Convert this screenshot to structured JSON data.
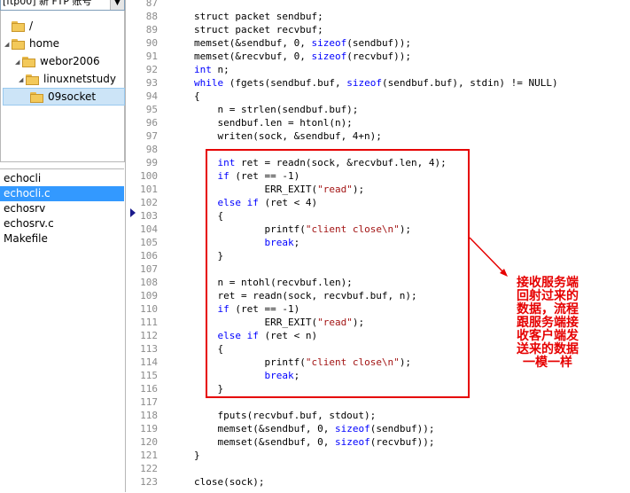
{
  "site_combo": {
    "label": "[ftp00] 新 FTP 账号"
  },
  "tree": [
    {
      "label": "/",
      "expander": ""
    },
    {
      "label": "home",
      "expander": "◢"
    },
    {
      "label": "webor2006",
      "expander": "◢"
    },
    {
      "label": "linuxnetstudy",
      "expander": "◢"
    },
    {
      "label": "09socket",
      "expander": ""
    }
  ],
  "files": [
    "echocli",
    "echocli.c",
    "echosrv",
    "echosrv.c",
    "Makefile"
  ],
  "selected_file": "echocli.c",
  "code_lines": [
    {
      "n": "87",
      "segs": []
    },
    {
      "n": "88",
      "segs": [
        {
          "t": "struct packet sendbuf;",
          "c": "n"
        }
      ]
    },
    {
      "n": "89",
      "segs": [
        {
          "t": "struct packet recvbuf;",
          "c": "n"
        }
      ]
    },
    {
      "n": "90",
      "segs": [
        {
          "t": "memset(&sendbuf, 0, ",
          "c": "n"
        },
        {
          "t": "sizeof",
          "c": "k"
        },
        {
          "t": "(sendbuf));",
          "c": "n"
        }
      ]
    },
    {
      "n": "91",
      "segs": [
        {
          "t": "memset(&recvbuf, 0, ",
          "c": "n"
        },
        {
          "t": "sizeof",
          "c": "k"
        },
        {
          "t": "(recvbuf));",
          "c": "n"
        }
      ]
    },
    {
      "n": "92",
      "segs": [
        {
          "t": "int",
          "c": "k"
        },
        {
          "t": " n;",
          "c": "n"
        }
      ]
    },
    {
      "n": "93",
      "segs": [
        {
          "t": "while",
          "c": "k"
        },
        {
          "t": " (fgets(sendbuf.buf, ",
          "c": "n"
        },
        {
          "t": "sizeof",
          "c": "k"
        },
        {
          "t": "(sendbuf.buf), stdin) != NULL)",
          "c": "n"
        }
      ]
    },
    {
      "n": "94",
      "segs": [
        {
          "t": "{",
          "c": "n"
        }
      ]
    },
    {
      "n": "95",
      "segs": [
        {
          "t": "    n = strlen(sendbuf.buf);",
          "c": "n"
        }
      ]
    },
    {
      "n": "96",
      "segs": [
        {
          "t": "    sendbuf.len = htonl(n);",
          "c": "n"
        }
      ]
    },
    {
      "n": "97",
      "segs": [
        {
          "t": "    writen(sock, &sendbuf, 4+n);",
          "c": "n"
        }
      ]
    },
    {
      "n": "98",
      "segs": []
    },
    {
      "n": "99",
      "segs": [
        {
          "t": "    ",
          "c": "n"
        },
        {
          "t": "int",
          "c": "k"
        },
        {
          "t": " ret = readn(sock, &recvbuf.len, 4);",
          "c": "n"
        }
      ]
    },
    {
      "n": "100",
      "segs": [
        {
          "t": "    ",
          "c": "n"
        },
        {
          "t": "if",
          "c": "k"
        },
        {
          "t": " (ret == -1)",
          "c": "n"
        }
      ]
    },
    {
      "n": "101",
      "segs": [
        {
          "t": "            ERR_EXIT(",
          "c": "n"
        },
        {
          "t": "\"read\"",
          "c": "s"
        },
        {
          "t": ");",
          "c": "n"
        }
      ]
    },
    {
      "n": "102",
      "segs": [
        {
          "t": "    ",
          "c": "n"
        },
        {
          "t": "else if",
          "c": "k"
        },
        {
          "t": " (ret < 4)",
          "c": "n"
        }
      ]
    },
    {
      "n": "103",
      "segs": [
        {
          "t": "    {",
          "c": "n"
        }
      ]
    },
    {
      "n": "104",
      "segs": [
        {
          "t": "            printf(",
          "c": "n"
        },
        {
          "t": "\"client close\\n\"",
          "c": "s"
        },
        {
          "t": ");",
          "c": "n"
        }
      ]
    },
    {
      "n": "105",
      "segs": [
        {
          "t": "            ",
          "c": "n"
        },
        {
          "t": "break",
          "c": "k"
        },
        {
          "t": ";",
          "c": "n"
        }
      ]
    },
    {
      "n": "106",
      "segs": [
        {
          "t": "    }",
          "c": "n"
        }
      ]
    },
    {
      "n": "107",
      "segs": []
    },
    {
      "n": "108",
      "segs": [
        {
          "t": "    n = ntohl(recvbuf.len);",
          "c": "n"
        }
      ]
    },
    {
      "n": "109",
      "segs": [
        {
          "t": "    ret = readn(sock, recvbuf.buf, n);",
          "c": "n"
        }
      ]
    },
    {
      "n": "110",
      "segs": [
        {
          "t": "    ",
          "c": "n"
        },
        {
          "t": "if",
          "c": "k"
        },
        {
          "t": " (ret == -1)",
          "c": "n"
        }
      ]
    },
    {
      "n": "111",
      "segs": [
        {
          "t": "            ERR_EXIT(",
          "c": "n"
        },
        {
          "t": "\"read\"",
          "c": "s"
        },
        {
          "t": ");",
          "c": "n"
        }
      ]
    },
    {
      "n": "112",
      "segs": [
        {
          "t": "    ",
          "c": "n"
        },
        {
          "t": "else if",
          "c": "k"
        },
        {
          "t": " (ret < n)",
          "c": "n"
        }
      ]
    },
    {
      "n": "113",
      "segs": [
        {
          "t": "    {",
          "c": "n"
        }
      ]
    },
    {
      "n": "114",
      "segs": [
        {
          "t": "            printf(",
          "c": "n"
        },
        {
          "t": "\"client close\\n\"",
          "c": "s"
        },
        {
          "t": ");",
          "c": "n"
        }
      ]
    },
    {
      "n": "115",
      "segs": [
        {
          "t": "            ",
          "c": "n"
        },
        {
          "t": "break",
          "c": "k"
        },
        {
          "t": ";",
          "c": "n"
        }
      ]
    },
    {
      "n": "116",
      "segs": [
        {
          "t": "    }",
          "c": "n"
        }
      ]
    },
    {
      "n": "117",
      "segs": []
    },
    {
      "n": "118",
      "segs": [
        {
          "t": "    fputs(recvbuf.buf, stdout);",
          "c": "n"
        }
      ]
    },
    {
      "n": "119",
      "segs": [
        {
          "t": "    memset(&sendbuf, 0, ",
          "c": "n"
        },
        {
          "t": "sizeof",
          "c": "k"
        },
        {
          "t": "(sendbuf));",
          "c": "n"
        }
      ]
    },
    {
      "n": "120",
      "segs": [
        {
          "t": "    memset(&sendbuf, 0, ",
          "c": "n"
        },
        {
          "t": "sizeof",
          "c": "k"
        },
        {
          "t": "(recvbuf));",
          "c": "n"
        }
      ]
    },
    {
      "n": "121",
      "segs": [
        {
          "t": "}",
          "c": "n"
        }
      ]
    },
    {
      "n": "122",
      "segs": []
    },
    {
      "n": "123",
      "segs": [
        {
          "t": "close(sock);",
          "c": "n"
        }
      ]
    }
  ],
  "annotation": {
    "lines": [
      "接收服务端",
      "回射过来的",
      "数据，流程",
      "跟服务端接",
      "收客户端发",
      "送来的数据",
      "一模一样"
    ]
  },
  "colors": {
    "keyword": "#0000ff",
    "string": "#a31515",
    "annotation": "#e60000",
    "selection": "#3399ff"
  },
  "icons": {
    "folder": "folder-icon",
    "dropdown": "chevron-down-icon",
    "current_line": "current-line-marker-icon"
  }
}
